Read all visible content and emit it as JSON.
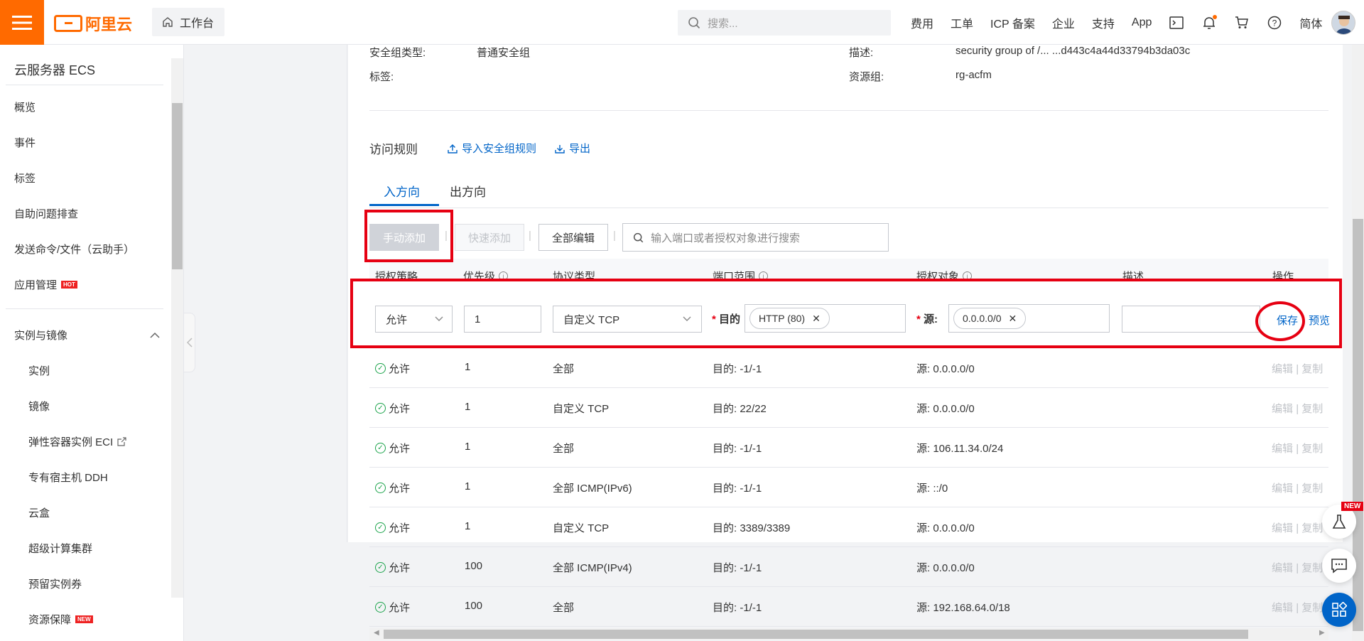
{
  "topbar": {
    "logo_text": "阿里云",
    "workbench": "工作台",
    "search_placeholder": "搜索...",
    "nav": [
      "费用",
      "工单",
      "ICP 备案",
      "企业",
      "支持",
      "App"
    ],
    "lang": "简体"
  },
  "sidebar": {
    "title": "云服务器 ECS",
    "items": [
      "概览",
      "事件",
      "标签",
      "自助问题排查",
      "发送命令/文件（云助手）",
      "应用管理"
    ],
    "hot_badge": "HOT",
    "group": "实例与镜像",
    "sub_items": [
      "实例",
      "镜像",
      "弹性容器实例 ECI",
      "专有宿主机 DDH",
      "云盒",
      "超级计算集群",
      "预留实例券",
      "资源保障"
    ],
    "new_badge": "NEW"
  },
  "info": {
    "type_label": "安全组类型:",
    "type_value": "普通安全组",
    "tag_label": "标签:",
    "desc_label": "描述:",
    "desc_value": "security group of /... ...d443c4a44d33794b3da03c",
    "rg_label": "资源组:",
    "rg_value": "rg-acfm"
  },
  "rules": {
    "title": "访问规则",
    "import_link": "导入安全组规则",
    "export_link": "导出",
    "tabs": [
      "入方向",
      "出方向"
    ],
    "btn_manual": "手动添加",
    "btn_quick": "快速添加",
    "btn_edit_all": "全部编辑",
    "search_placeholder": "输入端口或者授权对象进行搜索",
    "headers": [
      "授权策略",
      "优先级",
      "协议类型",
      "端口范围",
      "授权对象",
      "描述",
      "操作"
    ]
  },
  "edit_row": {
    "policy": "允许",
    "priority": "1",
    "protocol": "自定义 TCP",
    "dest_label": "目的",
    "dest_tag": "HTTP (80)",
    "src_label": "源",
    "src_tag": "0.0.0.0/0",
    "save": "保存",
    "preview": "预览"
  },
  "table_rows": [
    {
      "policy": "允许",
      "priority": "1",
      "protocol": "全部",
      "port": "目的: -1/-1",
      "source": "源: 0.0.0.0/0"
    },
    {
      "policy": "允许",
      "priority": "1",
      "protocol": "自定义 TCP",
      "port": "目的: 22/22",
      "source": "源: 0.0.0.0/0"
    },
    {
      "policy": "允许",
      "priority": "1",
      "protocol": "全部",
      "port": "目的: -1/-1",
      "source": "源: 106.11.34.0/24"
    },
    {
      "policy": "允许",
      "priority": "1",
      "protocol": "全部 ICMP(IPv6)",
      "port": "目的: -1/-1",
      "source": "源: ::/0"
    },
    {
      "policy": "允许",
      "priority": "1",
      "protocol": "自定义 TCP",
      "port": "目的: 3389/3389",
      "source": "源: 0.0.0.0/0"
    },
    {
      "policy": "允许",
      "priority": "100",
      "protocol": "全部 ICMP(IPv4)",
      "port": "目的: -1/-1",
      "source": "源: 0.0.0.0/0"
    },
    {
      "policy": "允许",
      "priority": "100",
      "protocol": "全部",
      "port": "目的: -1/-1",
      "source": "源: 192.168.64.0/18"
    }
  ],
  "row_ops": {
    "edit": "编辑",
    "sep": "|",
    "copy": "复制"
  },
  "float_badge": "NEW",
  "colors": {
    "brand": "#ff6a00",
    "link": "#0064c8",
    "highlight": "#e60012",
    "ok": "#1aa34a"
  }
}
